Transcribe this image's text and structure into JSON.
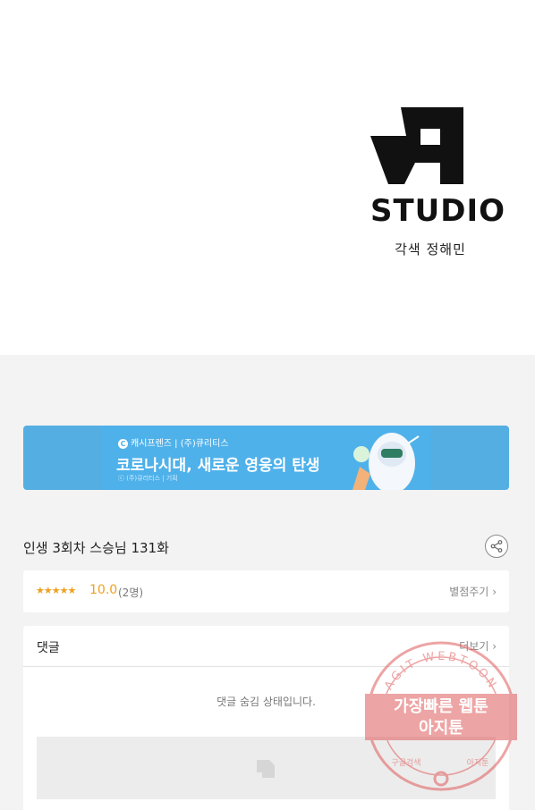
{
  "studio": {
    "logo_text": "STUDIO",
    "credit": "각색 정해민"
  },
  "banner": {
    "brand": "캐시프렌즈 | (주)큐리티스",
    "brand_icon": "C",
    "title": "코로나시대, 새로운 영웅의 탄생",
    "sub": "ⓒ (주)큐리티스  |  기획",
    "colors": {
      "bg": "#54aee2",
      "inner": "#4fb1ea"
    }
  },
  "episode": {
    "title": "인생 3회차 스승님 131화"
  },
  "rating": {
    "stars": "★★★★★",
    "score": "10.0",
    "count": "(2명)",
    "rate_link": "별점주기"
  },
  "comments": {
    "title": "댓글",
    "more": "더보기",
    "hidden_message": "댓글 숨김 상태입니다."
  },
  "watermark": {
    "arc_text": "AGIT WEBTOON",
    "line1": "가장빠른 웹툰",
    "line2": "아지툰",
    "bottom_left": "구글검색",
    "bottom_right": "아지툰",
    "color": "#e05a5a"
  },
  "colors": {
    "accent": "#f0a01c",
    "page_bg": "#f3f3f3"
  }
}
